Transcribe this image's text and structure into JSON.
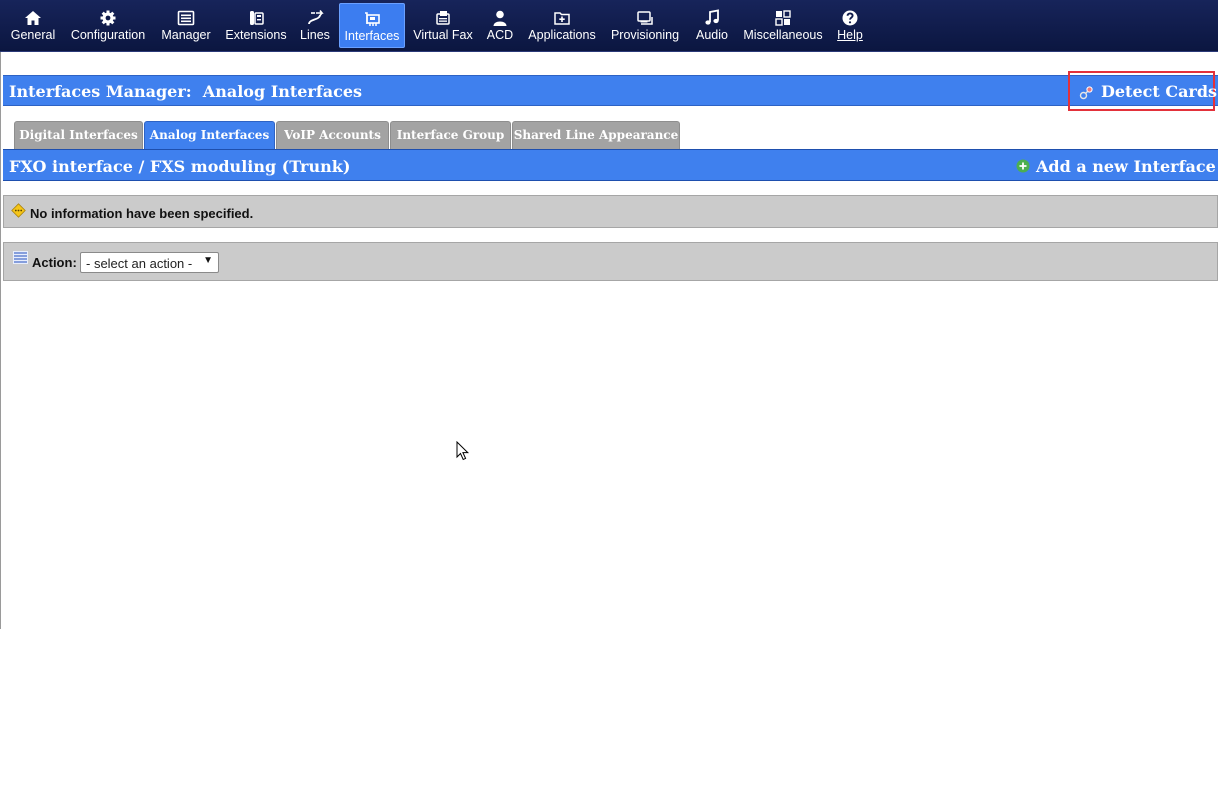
{
  "nav": {
    "items": [
      {
        "label": "General",
        "icon": "home-icon"
      },
      {
        "label": "Configuration",
        "icon": "gear-icon"
      },
      {
        "label": "Manager",
        "icon": "list-window-icon"
      },
      {
        "label": "Extensions",
        "icon": "phone-icon"
      },
      {
        "label": "Lines",
        "icon": "route-arrow-icon"
      },
      {
        "label": "Interfaces",
        "icon": "interface-card-icon",
        "active": true
      },
      {
        "label": "Virtual Fax",
        "icon": "fax-icon"
      },
      {
        "label": "ACD",
        "icon": "agent-icon"
      },
      {
        "label": "Applications",
        "icon": "folder-plus-icon"
      },
      {
        "label": "Provisioning",
        "icon": "device-icon"
      },
      {
        "label": "Audio",
        "icon": "music-note-icon"
      },
      {
        "label": "Miscellaneous",
        "icon": "grid-icon"
      },
      {
        "label": "Help",
        "icon": "question-icon"
      }
    ]
  },
  "header": {
    "title": "Interfaces Manager:  Analog Interfaces",
    "detect_cards_label": "Detect Cards"
  },
  "tabs": [
    {
      "label": "Digital Interfaces"
    },
    {
      "label": "Analog Interfaces",
      "active": true
    },
    {
      "label": "VoIP Accounts"
    },
    {
      "label": "Interface Group"
    },
    {
      "label": "Shared Line Appearance"
    }
  ],
  "section": {
    "title": "FXO interface / FXS moduling (Trunk)",
    "add_label": "Add a new Interface"
  },
  "info": {
    "message": "No information have been specified."
  },
  "action": {
    "label": "Action:",
    "selected": "- select an action -"
  },
  "colors": {
    "nav_bg": "#0f1b4b",
    "accent_blue": "#3f80ee",
    "tab_gray": "#a3a3a3",
    "panel_gray": "#cbcbcb",
    "highlight_red": "#e3313a",
    "add_green": "#4caf50"
  }
}
